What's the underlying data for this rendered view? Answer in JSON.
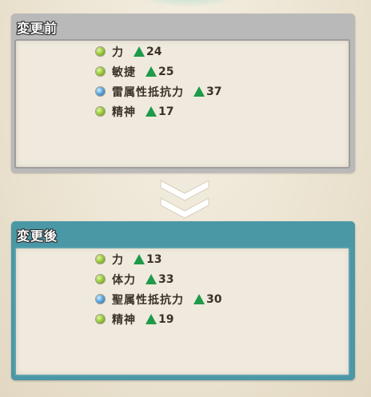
{
  "before": {
    "title": "変更前",
    "stats": [
      {
        "name": "力",
        "orb": "green",
        "value": "24"
      },
      {
        "name": "敏捷",
        "orb": "green",
        "value": "25"
      },
      {
        "name": "雷属性抵抗力",
        "orb": "blue",
        "value": "37"
      },
      {
        "name": "精神",
        "orb": "green",
        "value": "17"
      }
    ]
  },
  "after": {
    "title": "変更後",
    "stats": [
      {
        "name": "力",
        "orb": "green",
        "value": "13"
      },
      {
        "name": "体力",
        "orb": "green",
        "value": "33"
      },
      {
        "name": "聖属性抵抗力",
        "orb": "blue",
        "value": "30"
      },
      {
        "name": "精神",
        "orb": "green",
        "value": "19"
      }
    ]
  },
  "colors": {
    "before_header": "#b9b9b9",
    "after_header": "#4a97a6",
    "increase": "#1f9a4a",
    "arrow": "#ffffff"
  },
  "icons": {
    "stat_orb_green": "green-orb-icon",
    "stat_orb_blue": "blue-orb-icon",
    "increase": "up-triangle-icon",
    "transition": "double-chevron-down-icon"
  }
}
